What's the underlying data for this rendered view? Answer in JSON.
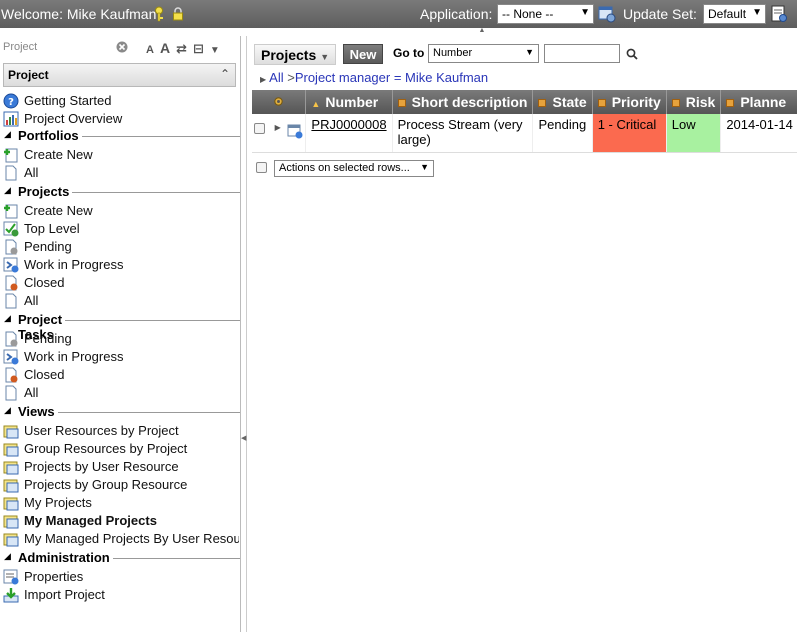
{
  "topbar": {
    "welcome": "Welcome: Mike Kaufman",
    "application_label": "Application:",
    "application_value": "-- None --",
    "update_set_label": "Update Set:",
    "update_set_value": "Default"
  },
  "navigator": {
    "filter_placeholder": "Project",
    "section_title": "Project",
    "items": [
      {
        "label": "Getting Started",
        "icon": "help-circle-icon"
      },
      {
        "label": "Project Overview",
        "icon": "chart-icon"
      }
    ],
    "groups": [
      {
        "label": "Portfolios",
        "items": [
          {
            "label": "Create New",
            "icon": "create-new-icon"
          },
          {
            "label": "All",
            "icon": "document-icon"
          }
        ]
      },
      {
        "label": "Projects",
        "items": [
          {
            "label": "Create New",
            "icon": "create-new-icon"
          },
          {
            "label": "Top Level",
            "icon": "top-level-icon"
          },
          {
            "label": "Pending",
            "icon": "pending-icon"
          },
          {
            "label": "Work in Progress",
            "icon": "work-in-progress-icon"
          },
          {
            "label": "Closed",
            "icon": "closed-icon"
          },
          {
            "label": "All",
            "icon": "document-icon"
          }
        ]
      },
      {
        "label": "Project Tasks",
        "items": [
          {
            "label": "Pending",
            "icon": "pending-icon"
          },
          {
            "label": "Work in Progress",
            "icon": "work-in-progress-icon"
          },
          {
            "label": "Closed",
            "icon": "closed-icon"
          },
          {
            "label": "All",
            "icon": "document-icon"
          }
        ]
      },
      {
        "label": "Views",
        "items": [
          {
            "label": "User Resources by Project",
            "icon": "view-icon"
          },
          {
            "label": "Group Resources by Project",
            "icon": "view-icon"
          },
          {
            "label": "Projects by User Resource",
            "icon": "view-icon"
          },
          {
            "label": "Projects by Group Resource",
            "icon": "view-icon"
          },
          {
            "label": "My Projects",
            "icon": "view-icon"
          },
          {
            "label": "My Managed Projects",
            "icon": "view-icon",
            "bold": true
          },
          {
            "label": "My Managed Projects By User Resou",
            "icon": "view-icon"
          }
        ]
      },
      {
        "label": "Administration",
        "items": [
          {
            "label": "Properties",
            "icon": "properties-icon"
          },
          {
            "label": "Import Project",
            "icon": "import-icon"
          }
        ]
      }
    ]
  },
  "list": {
    "title": "Projects",
    "new_label": "New",
    "goto_label": "Go to",
    "goto_field": "Number",
    "breadcrumb_all": "All",
    "breadcrumb_sep": ">",
    "breadcrumb_filter": "Project manager = Mike Kaufman",
    "columns": [
      "Number",
      "Short description",
      "State",
      "Priority",
      "Risk",
      "Planne"
    ],
    "rows": [
      {
        "number": "PRJ0000008",
        "short_description": "Process Stream (very large)",
        "state": "Pending",
        "priority": "1 - Critical",
        "risk": "Low",
        "planned": "2014-01-14"
      }
    ],
    "actions_label": "Actions on selected rows..."
  },
  "colors": {
    "header_bg": "#5d5d5d",
    "priority_critical": "#fb6a4f",
    "risk_low": "#a8f1a0",
    "link": "#2a36b8"
  }
}
